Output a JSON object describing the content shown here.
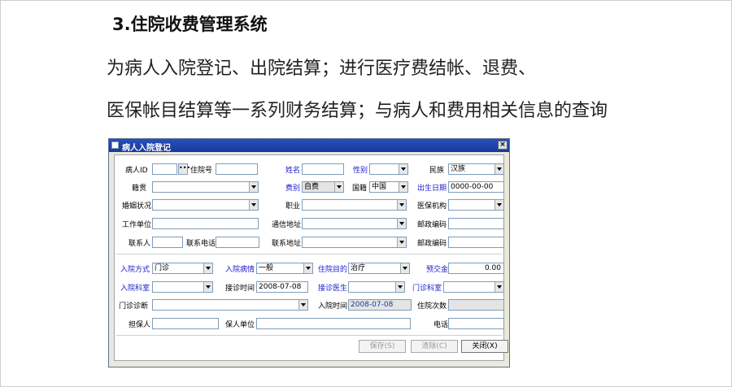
{
  "slide": {
    "title": "3.住院收费管理系统",
    "line1": "为病人入院登记、出院结算；进行医疗费结帐、退费、",
    "line2": "医保帐目结算等一系列财务结算；与病人和费用相关信息的查询"
  },
  "window": {
    "title": "病人入院登记",
    "close_glyph": "×"
  },
  "form": {
    "patient_id_label": "病人ID",
    "patient_id_value": "",
    "ellipsis": "•••",
    "admission_no_label": "住院号",
    "admission_no_value": "",
    "name_label": "姓名",
    "name_value": "",
    "gender_label": "性别",
    "gender_value": "",
    "ethnicity_label": "民族",
    "ethnicity_value": "汉族",
    "native_place_label": "籍贯",
    "native_place_value": "",
    "fee_type_label": "费别",
    "fee_type_value": "自费",
    "nationality_label": "国籍",
    "nationality_value": "中国",
    "birth_date_label": "出生日期",
    "birth_date_value": "0000-00-00",
    "marital_label": "婚姻状况",
    "marital_value": "",
    "occupation_label": "职业",
    "occupation_value": "",
    "insurance_org_label": "医保机构",
    "insurance_org_value": "",
    "work_unit_label": "工作单位",
    "work_unit_value": "",
    "mail_address_label": "通信地址",
    "mail_address_value": "",
    "postcode_label": "邮政编码",
    "postcode_value": "",
    "contact_label": "联系人",
    "contact_value": "",
    "contact_phone_label": "联系电话",
    "contact_phone_value": "",
    "contact_address_label": "联系地址",
    "contact_address_value": "",
    "postcode2_label": "邮政编码",
    "postcode2_value": "",
    "admission_mode_label": "入院方式",
    "admission_mode_value": "门诊",
    "admission_condition_label": "入院病情",
    "admission_condition_value": "一般",
    "admission_purpose_label": "住院目的",
    "admission_purpose_value": "治疗",
    "deposit_label": "预交金",
    "deposit_value": "0.00",
    "admission_dept_label": "入院科室",
    "admission_dept_value": "",
    "reception_time_label": "接诊时间",
    "reception_time_value": "2008-07-08",
    "reception_doctor_label": "接诊医生",
    "reception_doctor_value": "",
    "outpatient_dept_label": "门诊科室",
    "outpatient_dept_value": "",
    "outpatient_diag_label": "门诊诊断",
    "outpatient_diag_value": "",
    "admission_time_label": "入院时间",
    "admission_time_value": "2008-07-08",
    "admission_count_label": "住院次数",
    "admission_count_value": "",
    "guarantor_label": "担保人",
    "guarantor_value": "",
    "guarantor_unit_label": "保人单位",
    "guarantor_unit_value": "",
    "phone_label": "电话",
    "phone_value": ""
  },
  "buttons": {
    "save": "保存(S)",
    "clear": "清除(C)",
    "close": "关闭(X)"
  }
}
